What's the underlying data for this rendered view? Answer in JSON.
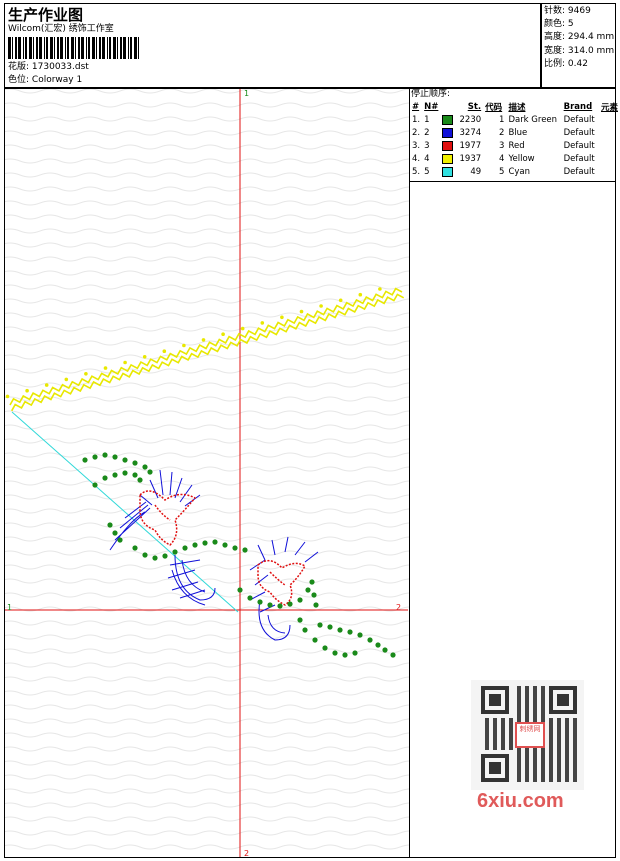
{
  "header": {
    "title": "生产作业图",
    "software": "Wilcom(汇宏) 绣饰工作室",
    "design_label": "花版:",
    "design_value": "1730033.dst",
    "colorway_label": "色位:",
    "colorway_value": "Colorway 1"
  },
  "stats": [
    {
      "label": "针数:",
      "value": "9469"
    },
    {
      "label": "颜色:",
      "value": "5"
    },
    {
      "label": "高度:",
      "value": "294.4 mm"
    },
    {
      "label": "宽度:",
      "value": "314.0 mm"
    },
    {
      "label": "比例:",
      "value": "0.42"
    }
  ],
  "sequence": {
    "title": "停止顺序:",
    "headers": {
      "hash": "#",
      "no": "N#",
      "st": "St.",
      "code": "代码",
      "desc": "描述",
      "brand": "Brand",
      "element": "元素"
    },
    "rows": [
      {
        "hash": "1.",
        "no": "1",
        "color": "#1a8a1a",
        "st": "2230",
        "code": "1",
        "desc": "Dark Green",
        "brand": "Default"
      },
      {
        "hash": "2.",
        "no": "2",
        "color": "#1010d8",
        "st": "3274",
        "code": "2",
        "desc": "Blue",
        "brand": "Default"
      },
      {
        "hash": "3.",
        "no": "3",
        "color": "#e01010",
        "st": "1977",
        "code": "3",
        "desc": "Red",
        "brand": "Default"
      },
      {
        "hash": "4.",
        "no": "4",
        "color": "#f0f000",
        "st": "1937",
        "code": "4",
        "desc": "Yellow",
        "brand": "Default"
      },
      {
        "hash": "5.",
        "no": "5",
        "color": "#30e0e0",
        "st": "49",
        "code": "5",
        "desc": "Cyan",
        "brand": "Default"
      }
    ]
  },
  "axes": {
    "top": "1",
    "bottom": "2",
    "left": "1",
    "right": "2"
  },
  "watermark": {
    "site": "6xiu.com",
    "stamp": "刺绣网"
  }
}
